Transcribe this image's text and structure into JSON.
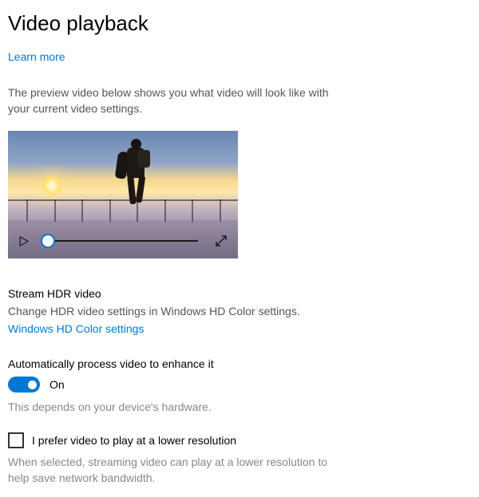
{
  "page_title": "Video playback",
  "learn_more": "Learn more",
  "preview_description": "The preview video below shows you what video will look like with your current video settings.",
  "hdr": {
    "title": "Stream HDR video",
    "description": "Change HDR video settings in Windows HD Color settings.",
    "link": "Windows HD Color settings"
  },
  "autoprocess": {
    "title": "Automatically process video to enhance it",
    "state_label": "On",
    "hint": "This depends on your device's hardware."
  },
  "lowres": {
    "label": "I prefer video to play at a lower resolution",
    "description": "When selected, streaming video can play at a lower resolution to help save network bandwidth."
  }
}
